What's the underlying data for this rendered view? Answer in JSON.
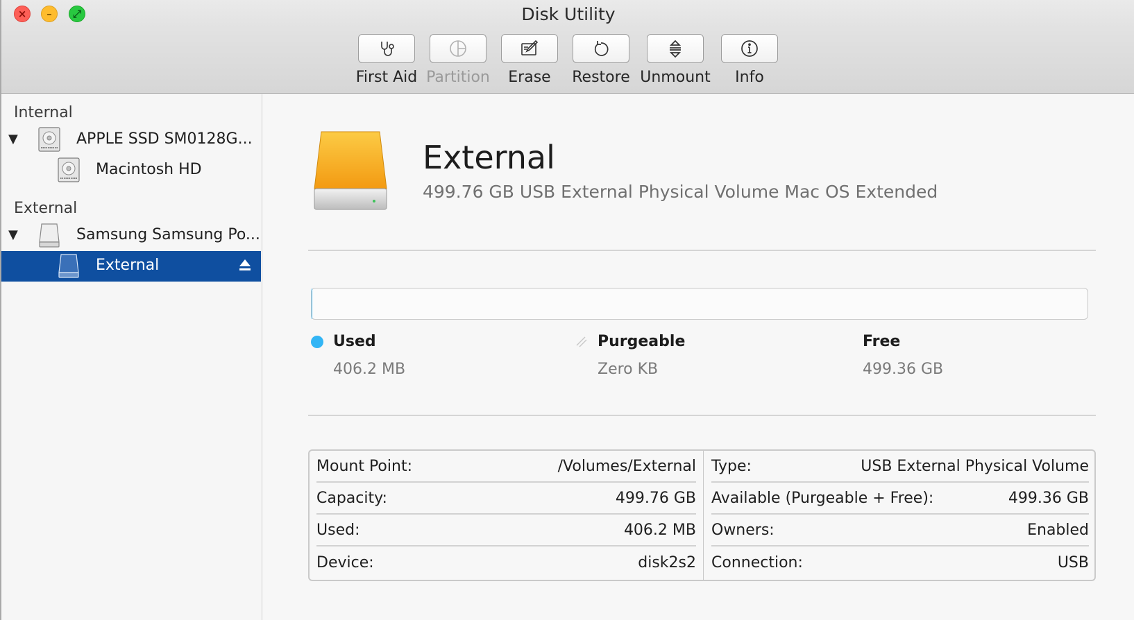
{
  "window": {
    "title": "Disk Utility"
  },
  "colors": {
    "used": "#32b5f5",
    "selection": "#0f4fa0",
    "drive_orange": "#f5a623"
  },
  "toolbar": {
    "first_aid": "First Aid",
    "partition": "Partition",
    "erase": "Erase",
    "restore": "Restore",
    "unmount": "Unmount",
    "info": "Info"
  },
  "sidebar": {
    "internal_header": "Internal",
    "external_header": "External",
    "apple_ssd": "APPLE SSD SM0128G...",
    "macintosh_hd": "Macintosh HD",
    "samsung": "Samsung Samsung Po...",
    "external": "External"
  },
  "volume": {
    "name": "External",
    "description": "499.76 GB USB External Physical Volume Mac OS Extended"
  },
  "usage": {
    "used_fraction": 0.0008,
    "used_label": "Used",
    "used_value": "406.2 MB",
    "purgeable_label": "Purgeable",
    "purgeable_value": "Zero KB",
    "free_label": "Free",
    "free_value": "499.36 GB"
  },
  "details": {
    "mount_point_label": "Mount Point:",
    "mount_point_value": "/Volumes/External",
    "capacity_label": "Capacity:",
    "capacity_value": "499.76 GB",
    "used_label": "Used:",
    "used_value": "406.2 MB",
    "device_label": "Device:",
    "device_value": "disk2s2",
    "type_label": "Type:",
    "type_value": "USB External Physical Volume",
    "available_label": "Available (Purgeable + Free):",
    "available_value": "499.36 GB",
    "owners_label": "Owners:",
    "owners_value": "Enabled",
    "connection_label": "Connection:",
    "connection_value": "USB"
  }
}
